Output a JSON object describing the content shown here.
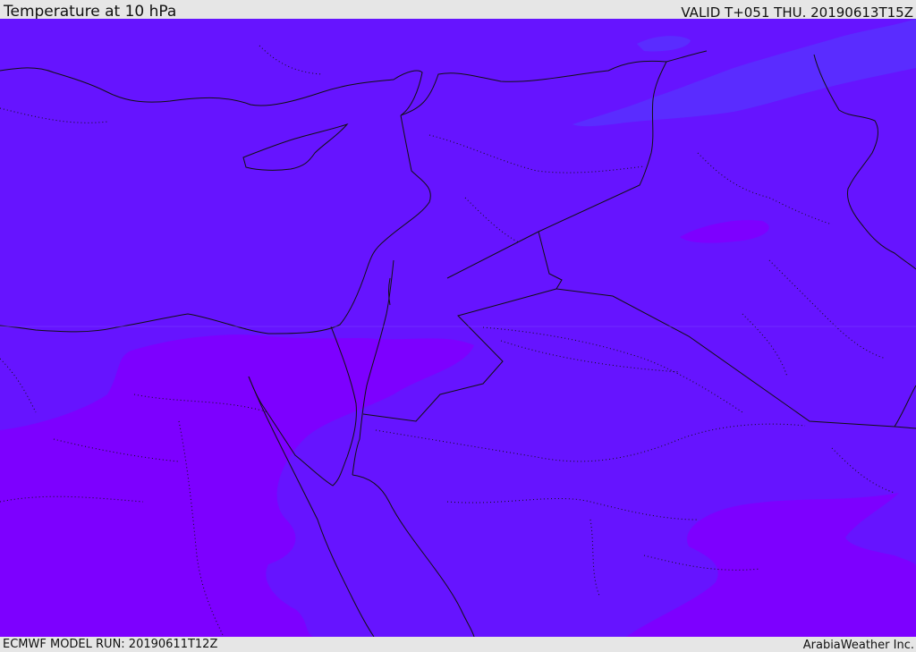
{
  "header": {
    "title": "Temperature at 10 hPa",
    "valid": "VALID T+051 THU. 20190613T15Z"
  },
  "footer": {
    "model_run": "ECMWF MODEL RUN: 20190611T12Z",
    "credit": "ArabiaWeather Inc."
  },
  "map": {
    "colors": {
      "main_fill": "#6614ff",
      "warm_fill": "#7d00ff",
      "cool_fill": "#5a2cff",
      "line": "#111111"
    }
  }
}
